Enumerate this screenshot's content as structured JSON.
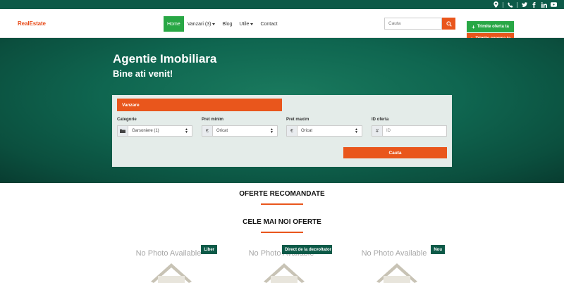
{
  "brand": {
    "logo": "RealEstate",
    "color": "#e74c1a"
  },
  "colors": {
    "primary_green": "#0d5a48",
    "accent_orange": "#e9561c",
    "button_green": "#28a745"
  },
  "topbar": {
    "icons": [
      "map-marker-icon",
      "phone-icon",
      "twitter-icon",
      "facebook-icon",
      "linkedin-icon",
      "youtube-icon"
    ]
  },
  "nav": {
    "items": [
      {
        "label": "Home",
        "active": true
      },
      {
        "label": "Vanzari (3)",
        "dropdown": true
      },
      {
        "label": "Blog"
      },
      {
        "label": "Utile",
        "dropdown": true
      },
      {
        "label": "Contact"
      }
    ]
  },
  "search": {
    "placeholder": "Cauta"
  },
  "cta": {
    "send_offer": "Trimite oferta ta",
    "send_request": "Trimite cererea ta"
  },
  "hero": {
    "title": "Agentie Imobiliara",
    "subtitle": "Bine ati venit!"
  },
  "filter": {
    "tab": "Vanzare",
    "fields": [
      {
        "label": "Categorie",
        "addon": "▪",
        "value": "Garsoniere (1)"
      },
      {
        "label": "Pret minim",
        "addon": "€",
        "value": "Oricat"
      },
      {
        "label": "Pret maxim",
        "addon": "€",
        "value": "Oricat"
      },
      {
        "label": "ID oferta",
        "addon": "#",
        "placeholder": "ID"
      }
    ],
    "submit": "Cauta"
  },
  "sections": {
    "recommended": "OFERTE RECOMANDATE",
    "latest": "CELE MAI NOI OFERTE"
  },
  "cards": [
    {
      "nophoto": "No Photo Available",
      "badge": "Liber"
    },
    {
      "nophoto": "No Photo Available",
      "badge": "Direct de la dezvoltator"
    },
    {
      "nophoto": "No Photo Available",
      "badge": "Nou"
    }
  ]
}
